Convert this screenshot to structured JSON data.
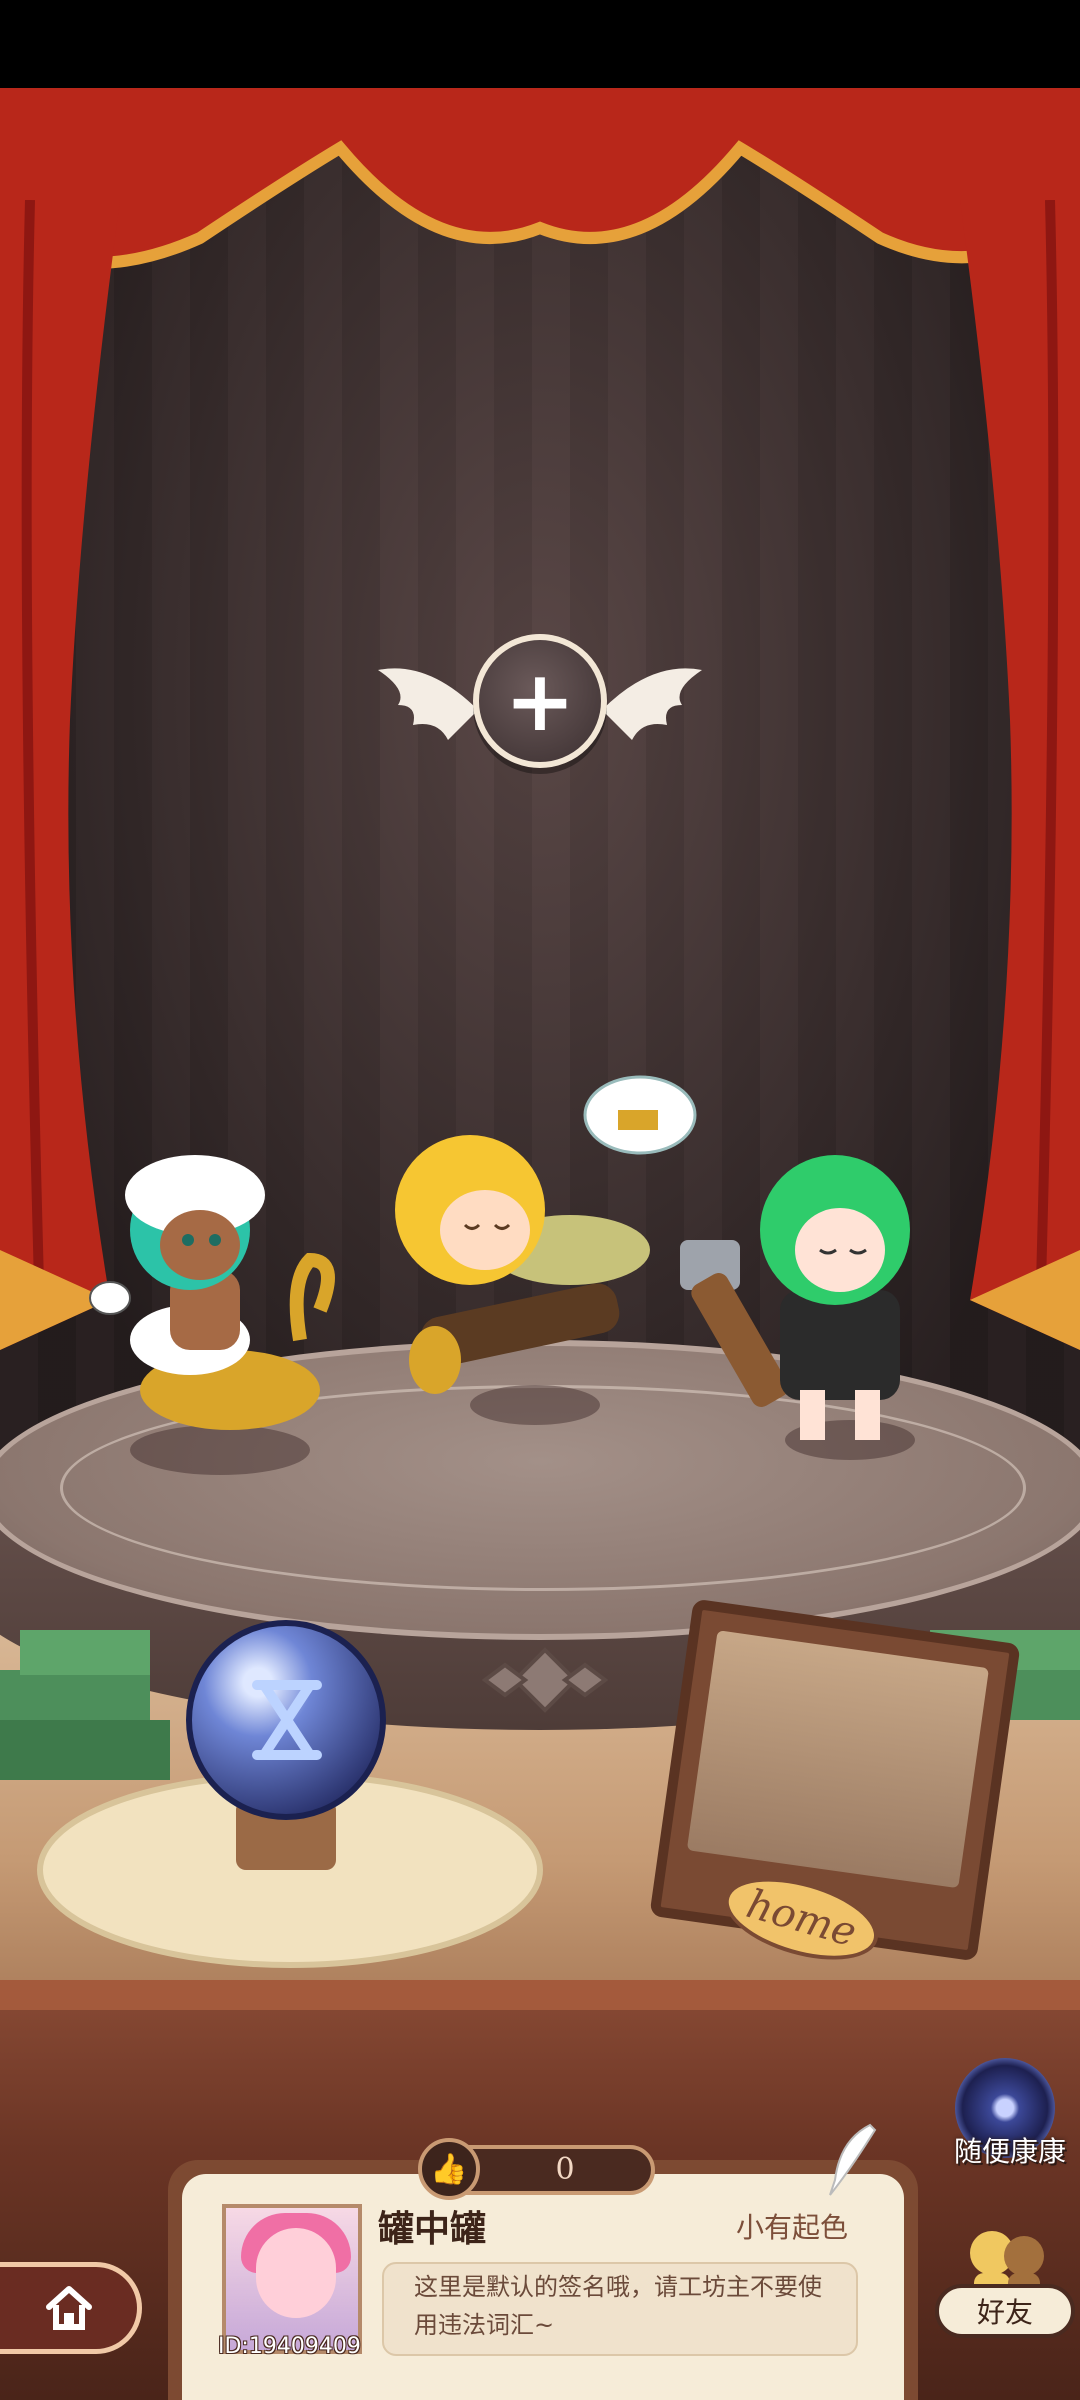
{
  "add_slot": {
    "icon": "plus-icon"
  },
  "random_visit": {
    "label": "随便康康",
    "icon": "swirl-portal-icon"
  },
  "likes": {
    "count": "0",
    "icon": "thumbs-up-icon"
  },
  "profile": {
    "username": "罐中罐",
    "rank": "小有起色",
    "user_id": "ID:19409409",
    "signature": "这里是默认的签名哦，请工坊主不要使用违法词汇~"
  },
  "home_frame": {
    "label": "home"
  },
  "nav": {
    "home_icon": "house-icon",
    "friends_label": "好友"
  },
  "colors": {
    "curtain": "#c8321f",
    "backdrop": "#4a3b3c",
    "card": "#f6ecd8",
    "wood": "#6b3525"
  }
}
